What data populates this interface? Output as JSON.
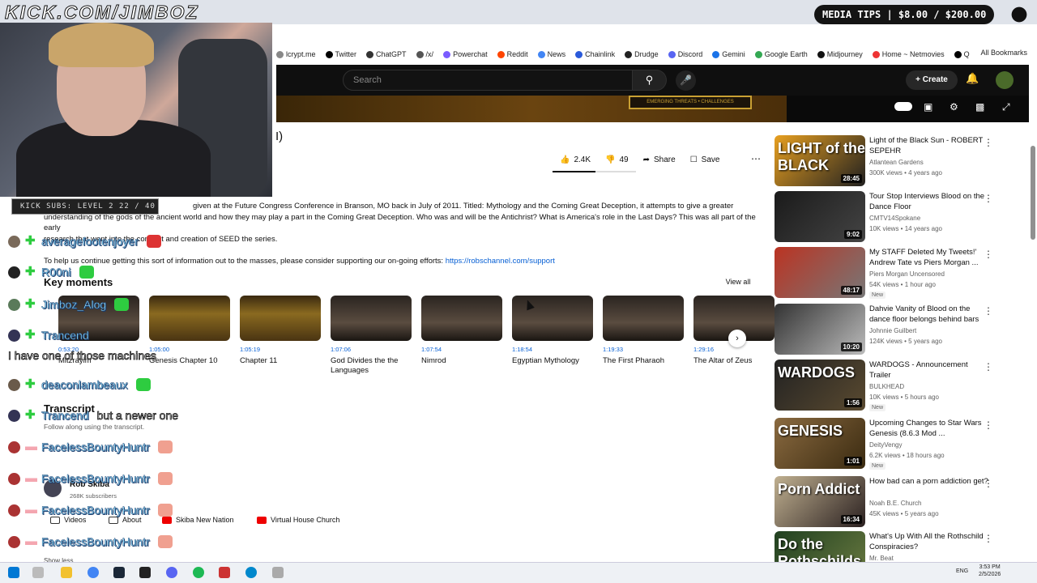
{
  "stream_overlay": {
    "url": "KICK.COM/JIMBOZ",
    "media_tips": "MEDIA TIPS | $8.00 / $200.00",
    "kick_subs": "KICK SUBS: LEVEL 2 22 / 40"
  },
  "bookmarks": {
    "items": [
      "lcrypt.me",
      "Twitter",
      "ChatGPT",
      "/x/",
      "Powerchat",
      "Reddit",
      "News",
      "Chainlink",
      "Drudge",
      "Discord",
      "Gemini",
      "Google Earth",
      "Midjourney",
      "Home ~ Netmovies",
      "Q"
    ],
    "all_bookmarks": "All Bookmarks"
  },
  "header": {
    "search_placeholder": "Search",
    "create_label": "Create"
  },
  "video": {
    "banner_text": "EMERGING THREATS • CHALLENGES",
    "title_fragment": "I)",
    "likes": "2.4K",
    "dislikes": "49",
    "share_label": "Share",
    "save_label": "Save",
    "likes_ratio": 0.51
  },
  "description": {
    "line1": "given at the Future Congress Conference in Branson, MO back in July of 2011. Titled: Mythology and the Coming Great Deception, it attempts to give a greater",
    "line2": "understanding of the gods of the ancient world and how they may play a part in the Coming Great Deception. Who was and will be the Antichrist? What is America's role in the Last Days? This was all part of the early",
    "line3": "research that went into the concept and creation of SEED the series.",
    "line4": "To help us continue getting this sort of information out to the masses, please consider supporting our on-going efforts:",
    "link": "https://robschannel.com/support"
  },
  "key_moments": {
    "title": "Key moments",
    "view_all": "View all",
    "items": [
      {
        "time": "0:53:20",
        "label": "Mitzrayim"
      },
      {
        "time": "1:05:00",
        "label": "Genesis Chapter 10"
      },
      {
        "time": "1:05:19",
        "label": "Chapter 11"
      },
      {
        "time": "1:07:06",
        "label": "God Divides the the Languages"
      },
      {
        "time": "1:07:54",
        "label": "Nimrod"
      },
      {
        "time": "1:18:54",
        "label": "Egyptian Mythology"
      },
      {
        "time": "1:19:33",
        "label": "The First Pharaoh"
      },
      {
        "time": "1:29:16",
        "label": "The Altar of Zeus"
      }
    ]
  },
  "transcript": {
    "title": "Transcript",
    "subtitle": "Follow along using the transcript."
  },
  "channel": {
    "name": "Rob Skiba",
    "subscribers": "268K subscribers",
    "tabs": [
      "Videos",
      "About",
      "Skiba New Nation",
      "Virtual House Church"
    ],
    "show_less": "Show less"
  },
  "chat": [
    {
      "name": "averagefootenjoyer",
      "msg": ""
    },
    {
      "name": "R00ni",
      "msg": ""
    },
    {
      "name": "Jimboz_Alog",
      "msg": ""
    },
    {
      "name": "Trancend",
      "msg": ""
    },
    {
      "name": "",
      "msg": "I have one of those machines"
    },
    {
      "name": "deaconlambeaux",
      "msg": ""
    },
    {
      "name": "Trancend",
      "msg": "but a newer one"
    },
    {
      "name": "FacelessBountyHuntr",
      "msg": ""
    },
    {
      "name": "FacelessBountyHuntr",
      "msg": ""
    },
    {
      "name": "FacelessBountyHuntr",
      "msg": ""
    },
    {
      "name": "FacelessBountyHuntr",
      "msg": ""
    }
  ],
  "recommendations": [
    {
      "title": "Light of the Black Sun - ROBERT SEPEHR",
      "channel": "Atlantean Gardens",
      "meta": "300K views • 4 years ago",
      "duration": "28:45",
      "thumb_text": "LIGHT of the BLACK",
      "new": ""
    },
    {
      "title": "Tour Stop Interviews Blood on the Dance Floor",
      "channel": "CMTV14Spokane",
      "meta": "10K views • 14 years ago",
      "duration": "9:02",
      "thumb_text": "",
      "new": ""
    },
    {
      "title": "My STAFF Deleted My Tweets!' Andrew Tate vs Piers Morgan ...",
      "channel": "Piers Morgan Uncensored",
      "meta": "54K views • 1 hour ago",
      "duration": "48:17",
      "thumb_text": "",
      "new": "New"
    },
    {
      "title": "Dahvie Vanity of Blood on the dance floor belongs behind bars",
      "channel": "Johnnie Guilbert",
      "meta": "124K views • 5 years ago",
      "duration": "10:20",
      "thumb_text": "",
      "new": ""
    },
    {
      "title": "WARDOGS - Announcement Trailer",
      "channel": "BULKHEAD",
      "meta": "10K views • 5 hours ago",
      "duration": "1:56",
      "thumb_text": "WARDOGS",
      "new": "New"
    },
    {
      "title": "Upcoming Changes to Star Wars Genesis (8.6.3 Mod ...",
      "channel": "DeityVengy",
      "meta": "6.2K views • 18 hours ago",
      "duration": "1:01",
      "thumb_text": "GENESIS",
      "new": "New"
    },
    {
      "title": "How bad can a porn addiction get?",
      "channel": "Noah B.E. Church",
      "meta": "45K views • 5 years ago",
      "duration": "16:34",
      "thumb_text": "Porn Addict",
      "new": ""
    },
    {
      "title": "What's Up With All the Rothschild Conspiracies?",
      "channel": "Mr. Beat",
      "meta": "",
      "duration": "",
      "thumb_text": "Do the Rothschilds Rule the World?",
      "new": ""
    }
  ],
  "taskbar": {
    "lang": "ENG",
    "time": "3:53 PM",
    "date": "2/5/2026"
  }
}
